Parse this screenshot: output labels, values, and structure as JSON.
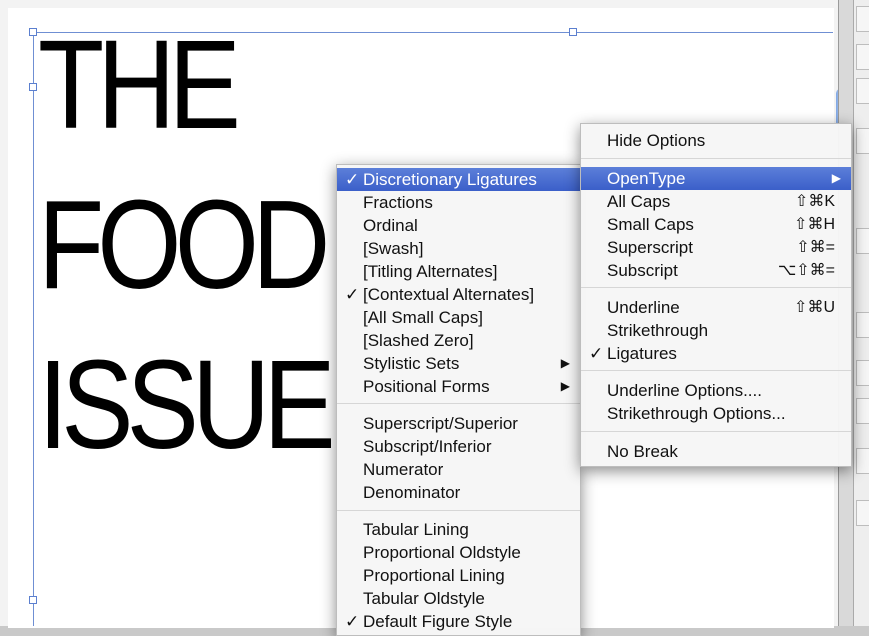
{
  "document": {
    "headline_lines": [
      "THE",
      "FOOD",
      "ISSUE"
    ]
  },
  "opentype_menu": {
    "items": [
      {
        "label": "Discretionary Ligatures",
        "checked": true,
        "highlighted": true,
        "submenu": false
      },
      {
        "label": "Fractions",
        "checked": false,
        "highlighted": false,
        "submenu": false
      },
      {
        "label": "Ordinal",
        "checked": false,
        "highlighted": false,
        "submenu": false
      },
      {
        "label": "[Swash]",
        "checked": false,
        "highlighted": false,
        "submenu": false
      },
      {
        "label": "[Titling Alternates]",
        "checked": false,
        "highlighted": false,
        "submenu": false
      },
      {
        "label": "[Contextual Alternates]",
        "checked": true,
        "highlighted": false,
        "submenu": false
      },
      {
        "label": "[All Small Caps]",
        "checked": false,
        "highlighted": false,
        "submenu": false
      },
      {
        "label": "[Slashed Zero]",
        "checked": false,
        "highlighted": false,
        "submenu": false
      },
      {
        "label": "Stylistic Sets",
        "checked": false,
        "highlighted": false,
        "submenu": true
      },
      {
        "label": "Positional Forms",
        "checked": false,
        "highlighted": false,
        "submenu": true
      },
      {
        "label": "Superscript/Superior",
        "checked": false,
        "highlighted": false,
        "submenu": false
      },
      {
        "label": "Subscript/Inferior",
        "checked": false,
        "highlighted": false,
        "submenu": false
      },
      {
        "label": "Numerator",
        "checked": false,
        "highlighted": false,
        "submenu": false
      },
      {
        "label": "Denominator",
        "checked": false,
        "highlighted": false,
        "submenu": false
      },
      {
        "label": "Tabular Lining",
        "checked": false,
        "highlighted": false,
        "submenu": false
      },
      {
        "label": "Proportional Oldstyle",
        "checked": false,
        "highlighted": false,
        "submenu": false
      },
      {
        "label": "Proportional Lining",
        "checked": false,
        "highlighted": false,
        "submenu": false
      },
      {
        "label": "Tabular Oldstyle",
        "checked": false,
        "highlighted": false,
        "submenu": false
      },
      {
        "label": "Default Figure Style",
        "checked": true,
        "highlighted": false,
        "submenu": false
      }
    ],
    "check_glyph": "✓",
    "submenu_glyph": "▶"
  },
  "options_menu": {
    "items": [
      {
        "label": "Hide Options",
        "shortcut": "",
        "checked": false,
        "highlighted": false,
        "submenu": false
      },
      {
        "label": "OpenType",
        "shortcut": "",
        "checked": false,
        "highlighted": true,
        "submenu": true
      },
      {
        "label": "All Caps",
        "shortcut": "⇧⌘K",
        "checked": false,
        "highlighted": false,
        "submenu": false
      },
      {
        "label": "Small Caps",
        "shortcut": "⇧⌘H",
        "checked": false,
        "highlighted": false,
        "submenu": false
      },
      {
        "label": "Superscript",
        "shortcut": "⇧⌘=",
        "checked": false,
        "highlighted": false,
        "submenu": false
      },
      {
        "label": "Subscript",
        "shortcut": "⌥⇧⌘=",
        "checked": false,
        "highlighted": false,
        "submenu": false
      },
      {
        "label": "Underline",
        "shortcut": "⇧⌘U",
        "checked": false,
        "highlighted": false,
        "submenu": false
      },
      {
        "label": "Strikethrough",
        "shortcut": "",
        "checked": false,
        "highlighted": false,
        "submenu": false
      },
      {
        "label": "Ligatures",
        "shortcut": "",
        "checked": true,
        "highlighted": false,
        "submenu": false
      },
      {
        "label": "Underline Options....",
        "shortcut": "",
        "checked": false,
        "highlighted": false,
        "submenu": false
      },
      {
        "label": "Strikethrough Options...",
        "shortcut": "",
        "checked": false,
        "highlighted": false,
        "submenu": false
      },
      {
        "label": "No Break",
        "shortcut": "",
        "checked": false,
        "highlighted": false,
        "submenu": false
      }
    ]
  },
  "colors": {
    "highlight": "#4668d1",
    "frame": "#6f8fd3"
  }
}
